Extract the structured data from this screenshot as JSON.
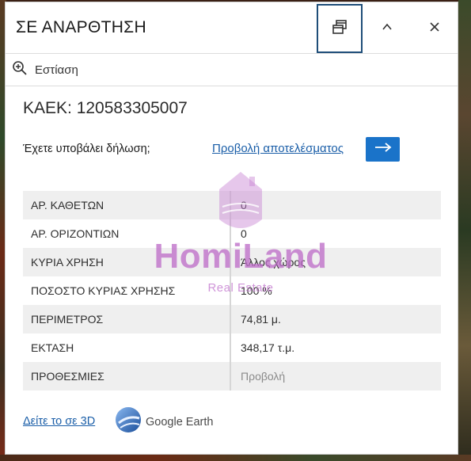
{
  "panel": {
    "title": "ΣΕ ΑΝΑΡΘΤΗΣΗ",
    "buttons": {
      "dock": "dock-icon",
      "collapse": "chevron-up-icon",
      "close": "close-icon"
    }
  },
  "toolbar": {
    "zoom_label": "Εστίαση",
    "zoom_icon": "zoom-in-icon"
  },
  "parcel": {
    "kaek": "ΚΑΕΚ: 120583305007"
  },
  "declaration": {
    "question": "Έχετε υποβάλει δήλωση;",
    "results_link": "Προβολή αποτελέσματος",
    "arrow_icon": "arrow-right-icon"
  },
  "attributes": [
    {
      "label": "ΑΡ. ΚΑΘΕΤΩΝ",
      "value": "0"
    },
    {
      "label": "ΑΡ. ΟΡΙΖΟΝΤΙΩΝ",
      "value": "0"
    },
    {
      "label": "ΚΥΡΙΑ ΧΡΗΣΗ",
      "value": "Άλλος χώρος"
    },
    {
      "label": "ΠΟΣΟΣΤΟ ΚΥΡΙΑΣ ΧΡΗΣΗΣ",
      "value": "100 %"
    },
    {
      "label": "ΠΕΡΙΜΕΤΡΟΣ",
      "value": "74,81 μ."
    },
    {
      "label": "ΕΚΤΑΣΗ",
      "value": "348,17 τ.μ."
    },
    {
      "label": "ΠΡΟΘΕΣΜΙΕΣ",
      "value": "Προβολή"
    }
  ],
  "footer": {
    "view_3d": "Δείτε το σε 3D",
    "google_earth": "Google Earth"
  },
  "watermark": {
    "brand": "HomiLand",
    "tagline": "Real Estate"
  },
  "colors": {
    "accent": "#1a73c9",
    "link": "#1a5ea8",
    "dock_border": "#1f4e79",
    "watermark": "#be6ec8"
  }
}
